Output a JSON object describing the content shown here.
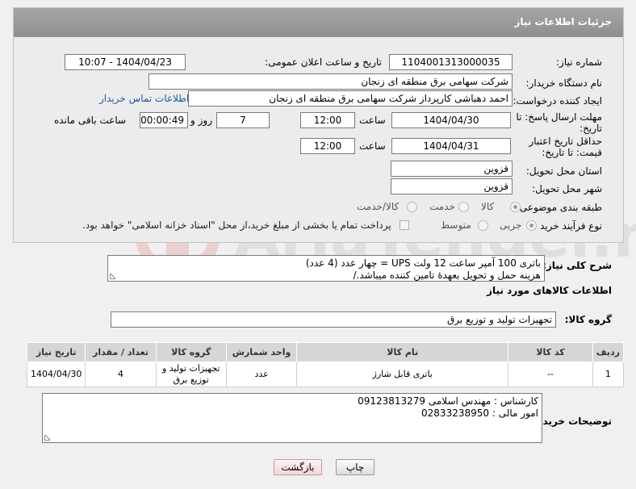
{
  "panel": {
    "title": "جزئیات اطلاعات نیاز"
  },
  "fields": {
    "need_number_label": "شماره نیاز:",
    "need_number": "1104001313000035",
    "announce_label": "تاریخ و ساعت اعلان عمومی:",
    "announce_value": "1404/04/23 - 10:07",
    "buyer_org_label": "نام دستگاه خریدار:",
    "buyer_org": "شرکت سهامی برق منطقه ای زنجان",
    "creator_label": "ایجاد کننده درخواست:",
    "creator": "احمد دهباشی کارپرداز شرکت سهامی برق منطقه ای زنجان",
    "contact_link": "اطلاعات تماس خریدار",
    "deadline_label": "مهلت ارسال پاسخ: تا تاریخ:",
    "deadline_date": "1404/04/30",
    "time_label": "ساعت",
    "deadline_time": "12:00",
    "days_value": "7",
    "days_label": "روز و",
    "remaining_time": "00:00:49",
    "remaining_label": "ساعت باقی مانده",
    "validity_label": "حداقل تاریخ اعتبار قیمت: تا تاریخ:",
    "validity_date": "1404/04/31",
    "validity_time": "12:00",
    "province_label": "استان محل تحویل:",
    "province": "قزوین",
    "city_label": "شهر محل تحویل:",
    "city": "قزوین",
    "category_label": "طبقه بندی موضوعی:",
    "category_options": [
      "کالا",
      "خدمت",
      "کالا/خدمت"
    ],
    "process_label": "نوع فرآیند خرید :",
    "process_options": [
      "جزیی",
      "متوسط"
    ],
    "payment_note": "پرداخت تمام یا بخشی از مبلغ خرید،از محل \"اسناد خزانه اسلامی\" خواهد بود."
  },
  "description": {
    "label": "شرح کلی نیاز:",
    "line1": "باتری 100 آمپر ساعت 12 ولت  UPS   =  چهار  عدد (4 عدد)",
    "line2": "هزینه حمل و تحویل بعهدهٔ تامین کننده میباشد./"
  },
  "goods_info": {
    "heading": "اطلاعات کالاهای مورد نیاز",
    "group_label": "گروه کالا:",
    "group_value": "تجهیزات تولید و توزیع برق"
  },
  "table": {
    "headers": [
      "ردیف",
      "کد کالا",
      "نام کالا",
      "واحد شمارش",
      "گروه کالا",
      "تعداد / مقدار",
      "تاریخ نیاز"
    ],
    "rows": [
      {
        "row": "1",
        "code": "--",
        "name": "باتری قابل شارژ",
        "unit": "عدد",
        "group": "تجهیزات تولید و توزیع برق",
        "qty": "4",
        "date": "1404/04/30"
      }
    ]
  },
  "buyer_notes": {
    "label": "توضیحات خریدار:",
    "line1": "کارشناس : مهندس اسلامی 09123813279",
    "line2": "امور مالی : 02833238950"
  },
  "buttons": {
    "print": "چاپ",
    "back": "بازگشت"
  },
  "watermark": {
    "text": "AriaTender.neT"
  },
  "colors": {
    "header_bg": "#999999",
    "link": "#1a5aa8",
    "back_button": "#f3d6d6"
  }
}
